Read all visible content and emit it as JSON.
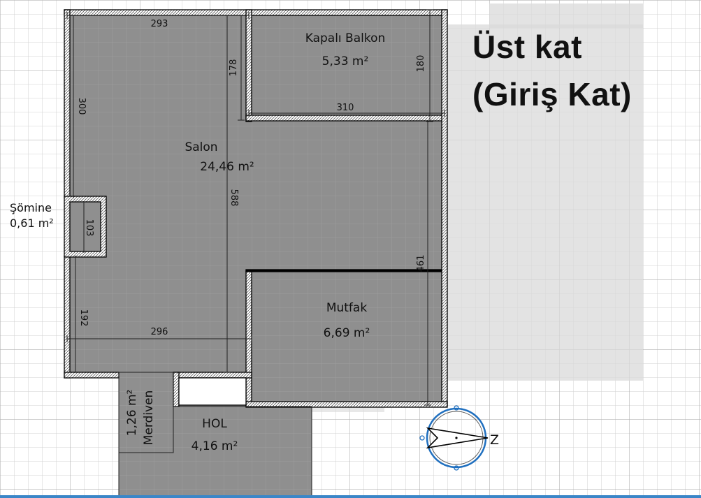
{
  "page": {
    "title_line_1": "Üst kat",
    "title_line_2": "(Giriş Kat)"
  },
  "rooms": {
    "salon": {
      "name": "Salon",
      "area": "24,46 m²"
    },
    "kapali_balkon": {
      "name": "Kapalı Balkon",
      "area": "5,33 m²"
    },
    "somine": {
      "name": "Şömine",
      "area": "0,61 m²"
    },
    "mutfak": {
      "name": "Mutfak",
      "area": "6,69 m²"
    },
    "hol": {
      "name": "HOL",
      "area": "4,16 m²"
    },
    "merdiven": {
      "name": "Merdiven",
      "area": "1,26 m²"
    }
  },
  "dimensions": {
    "salon_top_width": "293",
    "balkon_depth": "178",
    "balkon_side": "180",
    "balkon_width": "310",
    "salon_left_height": "300",
    "salon_height": "588",
    "somine_width": "103",
    "mutfak_height": "461",
    "salon_lower_height": "192",
    "salon_bottom_width": "296"
  },
  "compass": {
    "label": "Z"
  },
  "colors": {
    "grid_line": "#c9c9c9",
    "room_fill": "#8e8e8e",
    "wall": "#000000",
    "compass_ring": "#1f6fbf",
    "accent_bar": "#3a86c8"
  }
}
